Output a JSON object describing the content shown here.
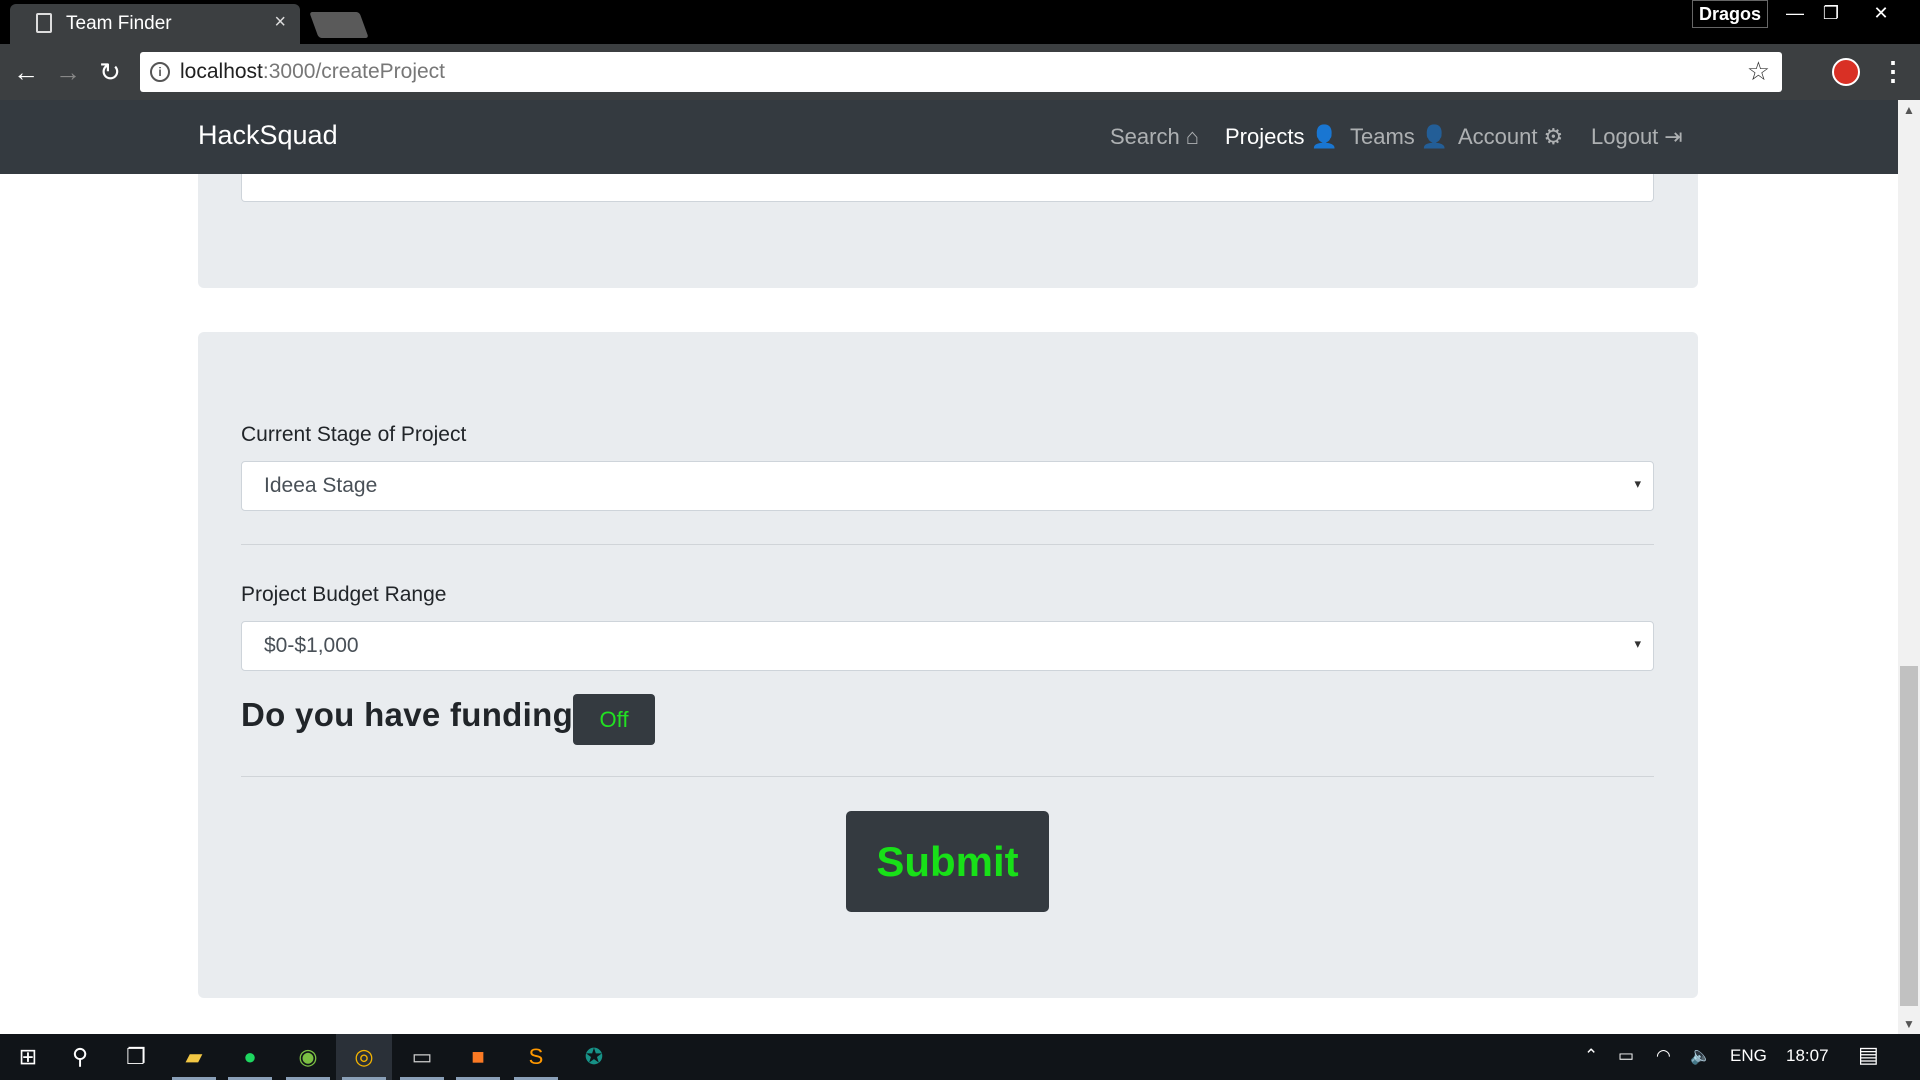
{
  "browser": {
    "tab_title": "Team Finder",
    "tab_close": "×",
    "user_name": "Dragos",
    "window_minimize": "—",
    "window_restore": "❐",
    "window_close": "✕",
    "url_host": "localhost",
    "url_path": ":3000/createProject",
    "back": "←",
    "forward": "→",
    "reload": "↻",
    "info_glyph": "i",
    "star": "☆",
    "menu": "⋮"
  },
  "navbar": {
    "brand": "HackSquad",
    "links": [
      {
        "label": "Search",
        "icon": "home-icon",
        "glyph": "⌂"
      },
      {
        "label": "Projects",
        "icon": "user-icon",
        "glyph": "👤"
      },
      {
        "label": "Teams",
        "icon": "user-icon",
        "glyph": "👤"
      },
      {
        "label": "Account",
        "icon": "gears-icon",
        "glyph": "⚙"
      },
      {
        "label": "Logout",
        "icon": "sign-out-icon",
        "glyph": "⇥"
      }
    ],
    "active": "Projects"
  },
  "form": {
    "stage_label": "Current Stage of Project",
    "stage_value": "Ideea Stage",
    "budget_label": "Project Budget Range",
    "budget_value": "$0-$1,000",
    "caret": "▾",
    "funding_question": "Do you have funding?",
    "funding_toggle": "Off",
    "submit": "Submit"
  },
  "taskbar": {
    "language": "ENG",
    "time": "18:07",
    "icons": [
      "windows-start-icon",
      "search-icon",
      "task-view-icon",
      "file-explorer-icon",
      "spotify-icon",
      "utorrent-icon",
      "chrome-icon",
      "terminal-icon",
      "xampp-icon",
      "sublime-text-icon",
      "gitkraken-icon"
    ]
  },
  "colors": {
    "navbar": "#343a40",
    "card": "#e9ecef",
    "accent_green": "#18e018"
  }
}
